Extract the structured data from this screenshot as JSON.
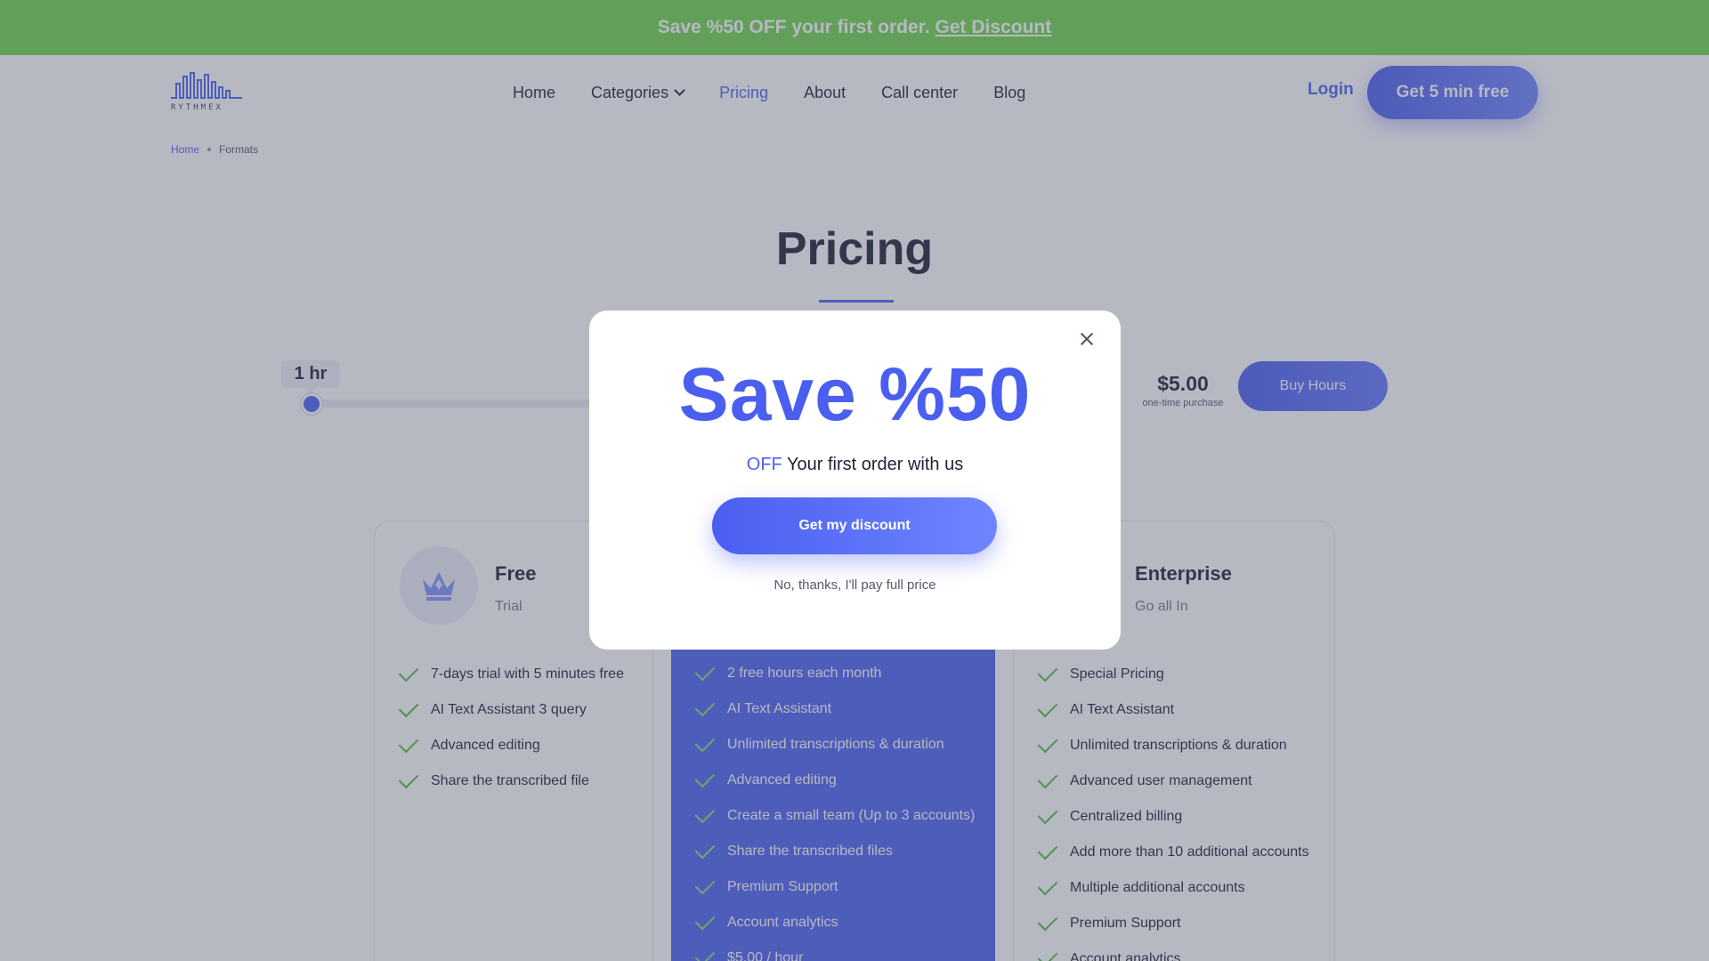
{
  "promo": {
    "text": "Save %50 OFF your first order.",
    "link": "Get Discount"
  },
  "header": {
    "logo_text": "RYTHMEX",
    "nav": [
      {
        "label": "Home"
      },
      {
        "label": "Categories"
      },
      {
        "label": "Pricing"
      },
      {
        "label": "About"
      },
      {
        "label": "Call center"
      },
      {
        "label": "Blog"
      }
    ],
    "login": "Login",
    "cta": "Get 5 min free"
  },
  "breadcrumb": {
    "home": "Home",
    "current": "Formats"
  },
  "page": {
    "title": "Pricing"
  },
  "slider": {
    "value_label": "1 hr",
    "position_fraction": 0.0
  },
  "purchase": {
    "price": "$5.00",
    "note": "one-time purchase",
    "button": "Buy Hours"
  },
  "plans": {
    "free": {
      "name": "Free",
      "subtitle": "Trial",
      "features": [
        "7-days trial with 5 minutes free",
        "AI Text Assistant 3 query",
        "Advanced editing",
        "Share the transcribed file"
      ]
    },
    "pro": {
      "features": [
        "2 free hours each month",
        "AI Text Assistant",
        "Unlimited transcriptions & duration",
        "Advanced editing",
        "Create a small team (Up to 3 accounts)",
        "Share the transcribed files",
        "Premium Support",
        "Account analytics",
        "$5.00 / hour"
      ]
    },
    "enterprise": {
      "name": "Enterprise",
      "subtitle": "Go all In",
      "features": [
        "Special Pricing",
        "AI Text Assistant",
        "Unlimited transcriptions & duration",
        "Advanced user management",
        "Centralized billing",
        "Add more than 10 additional accounts",
        "Multiple additional accounts",
        "Premium Support",
        "Account analytics"
      ]
    }
  },
  "modal": {
    "headline": "Save %50",
    "sub_accent": "OFF",
    "sub_text": "Your first order with us",
    "button": "Get my discount",
    "decline": "No, thanks, I'll pay full price"
  },
  "colors": {
    "accent": "#4a63f0",
    "promo_bg": "#6ed64b",
    "check": "#4fc13a",
    "pro_card": "#4c63f2"
  }
}
